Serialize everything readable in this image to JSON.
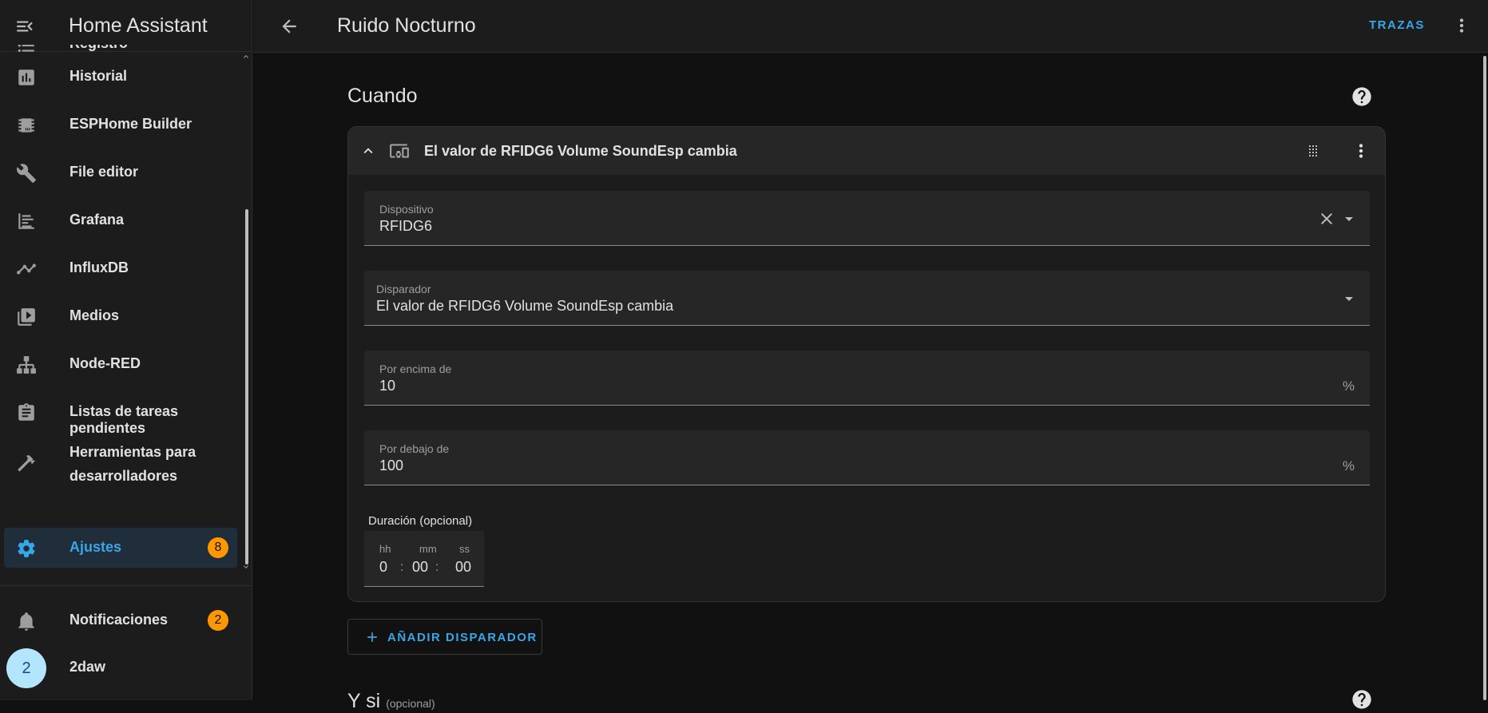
{
  "app": {
    "title": "Home Assistant"
  },
  "sidebar": {
    "items": [
      {
        "label": "Registro",
        "icon": "list-icon"
      },
      {
        "label": "Historial",
        "icon": "chart-box-icon"
      },
      {
        "label": "ESPHome Builder",
        "icon": "chip-icon"
      },
      {
        "label": "File editor",
        "icon": "wrench-icon"
      },
      {
        "label": "Grafana",
        "icon": "grafana-icon"
      },
      {
        "label": "InfluxDB",
        "icon": "line-chart-icon"
      },
      {
        "label": "Medios",
        "icon": "play-box-icon"
      },
      {
        "label": "Node-RED",
        "icon": "sitemap-icon"
      },
      {
        "label": "Listas de tareas pendientes",
        "icon": "clipboard-list-icon"
      },
      {
        "label": "Herramientas para desarrolladores",
        "icon": "hammer-icon"
      },
      {
        "label": "Ajustes",
        "icon": "cog-icon",
        "badge": "8",
        "active": true
      }
    ],
    "notifications": {
      "label": "Notificaciones",
      "badge": "2"
    },
    "user": {
      "label": "2daw",
      "initial": "2"
    }
  },
  "topbar": {
    "title": "Ruido Nocturno",
    "traces": "TRAZAS"
  },
  "when": {
    "title": "Cuando",
    "trigger": {
      "title": "El valor de RFIDG6 Volume SoundEsp cambia",
      "device": {
        "label": "Dispositivo",
        "value": "RFIDG6"
      },
      "trigger_field": {
        "label": "Disparador",
        "value": "El valor de RFIDG6 Volume SoundEsp cambia"
      },
      "above": {
        "label": "Por encima de",
        "value": "10",
        "unit": "%"
      },
      "below": {
        "label": "Por debajo de",
        "value": "100",
        "unit": "%"
      },
      "duration": {
        "label": "Duración (opcional)",
        "hh_label": "hh",
        "mm_label": "mm",
        "ss_label": "ss",
        "hh": "0",
        "mm": "00",
        "ss": "00"
      }
    },
    "add_trigger": "AÑADIR DISPARADOR"
  },
  "and_if": {
    "title": "Y si",
    "optional": "(opcional)"
  },
  "colors": {
    "accent": "#38a6e7",
    "badge": "#ff9800",
    "active_bg": "#1f2e3a"
  }
}
